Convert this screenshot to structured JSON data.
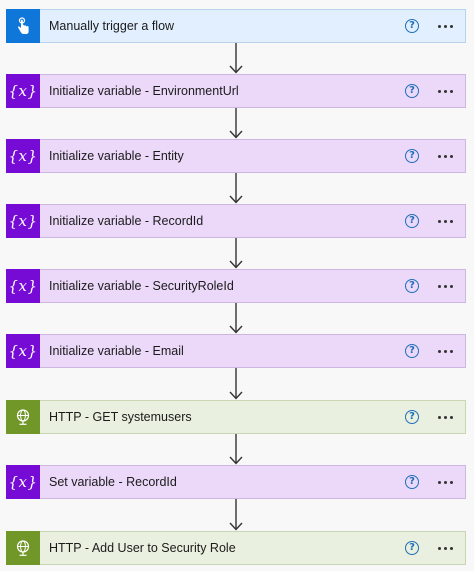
{
  "flow": {
    "steps": [
      {
        "kind": "trigger",
        "icon": "touch-hand-icon",
        "title": "Manually trigger a flow",
        "help": "?"
      },
      {
        "kind": "variable",
        "icon": "variable-icon",
        "title": "Initialize variable - EnvironmentUrl",
        "help": "?"
      },
      {
        "kind": "variable",
        "icon": "variable-icon",
        "title": "Initialize variable - Entity",
        "help": "?"
      },
      {
        "kind": "variable",
        "icon": "variable-icon",
        "title": "Initialize variable - RecordId",
        "help": "?"
      },
      {
        "kind": "variable",
        "icon": "variable-icon",
        "title": "Initialize variable - SecurityRoleId",
        "help": "?"
      },
      {
        "kind": "variable",
        "icon": "variable-icon",
        "title": "Initialize variable - Email",
        "help": "?"
      },
      {
        "kind": "http",
        "icon": "globe-icon",
        "title": "HTTP - GET systemusers",
        "help": "?"
      },
      {
        "kind": "variable",
        "icon": "variable-icon",
        "title": "Set variable - RecordId",
        "help": "?"
      },
      {
        "kind": "http",
        "icon": "globe-icon",
        "title": "HTTP - Add User to Security Role",
        "help": "?"
      }
    ],
    "variable_glyph": "{x}"
  },
  "colors": {
    "trigger_accent": "#0f77d9",
    "variable_accent": "#770bd6",
    "http_accent": "#709727",
    "help_icon": "#1f6fb8"
  }
}
